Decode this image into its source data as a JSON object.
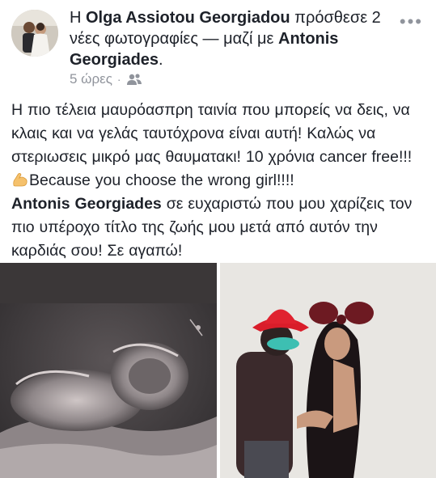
{
  "post": {
    "prefix": "Η ",
    "author": "Olga Assiotou Georgiadou",
    "action_text": " πρόσθεσε 2 νέες φωτογραφίες — μαζί με ",
    "tagged": "Antonis Georgiades",
    "suffix": ".",
    "time": "5 ώρες",
    "separator": "·",
    "audience_icon": "friends-icon",
    "more_label": "•••"
  },
  "body": {
    "line1": "Η πιο τέλεια  μαυρόασπρη ταινία που μπορείς να δεις, να κλαις και να γελάς ταυτόχρονα είναι αυτή! Καλώς να στεριωσεις μικρό μας θαυματακι! 10 χρόνια cancer free!!! ",
    "emoji_icon": "flexed-biceps-icon",
    "line2": "Because you choose the wrong girl!!!!",
    "mention": "Antonis Georgiades",
    "line3": " σε ευχαριστώ που μου χαρίζεις τον πιο υπέροχο τίτλο της ζωής μου μετά από αυτόν την καρδιάς σου! Σε αγαπώ!"
  },
  "colors": {
    "text": "#1d2129",
    "meta": "#90949c",
    "background": "#ffffff"
  }
}
